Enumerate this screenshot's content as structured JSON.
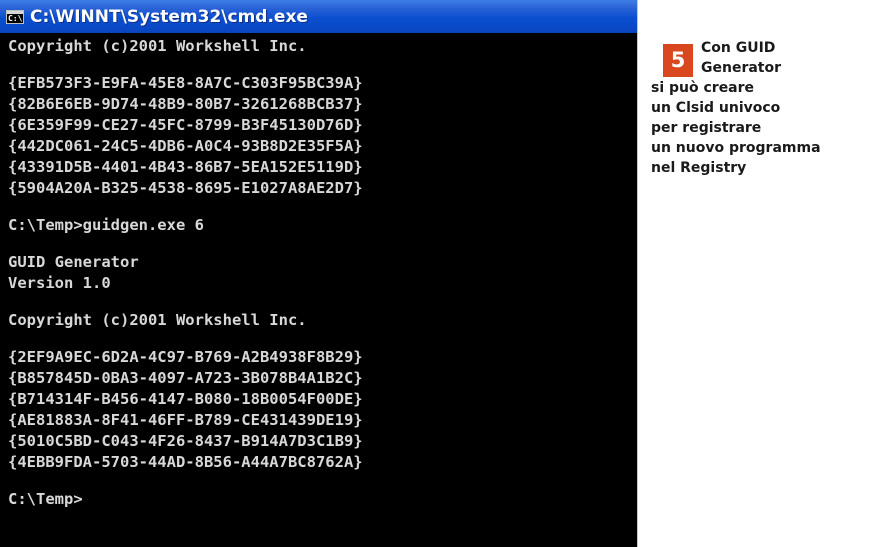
{
  "window": {
    "title": "C:\\WINNT\\System32\\cmd.exe",
    "icon": "console-icon",
    "icon_glyph": "C:\\"
  },
  "console": {
    "lines": [
      "Copyright (c)2001 Workshell Inc.",
      "",
      "{EFB573F3-E9FA-45E8-8A7C-C303F95BC39A}",
      "{82B6E6EB-9D74-48B9-80B7-3261268BCB37}",
      "{6E359F99-CE27-45FC-8799-B3F45130D76D}",
      "{442DC061-24C5-4DB6-A0C4-93B8D2E35F5A}",
      "{43391D5B-4401-4B43-86B7-5EA152E5119D}",
      "{5904A20A-B325-4538-8695-E1027A8AE2D7}",
      "",
      "C:\\Temp>guidgen.exe 6",
      "",
      "GUID Generator",
      "Version 1.0",
      "",
      "Copyright (c)2001 Workshell Inc.",
      "",
      "{2EF9A9EC-6D2A-4C97-B769-A2B4938F8B29}",
      "{B857845D-0BA3-4097-A723-3B078B4A1B2C}",
      "{B714314F-B456-4147-B080-18B0054F00DE}",
      "{AE81883A-8F41-46FF-B789-CE431439DE19}",
      "{5010C5BD-C043-4F26-8437-B914A7D3C1B9}",
      "{4EBB9FDA-5703-44AD-8B56-A44A7BC8762A}",
      "",
      "C:\\Temp>"
    ]
  },
  "caption": {
    "step_number": "5",
    "head_lines": [
      "Con GUID",
      "Generator"
    ],
    "body_lines": [
      "si può creare",
      "un Clsid univoco",
      "per registrare",
      "un nuovo programma",
      "nel Registry"
    ]
  },
  "colors": {
    "titlebar": "#0a4fd0",
    "console_background": "#000000",
    "console_text": "#d8d8d8",
    "badge": "#d9471f"
  }
}
